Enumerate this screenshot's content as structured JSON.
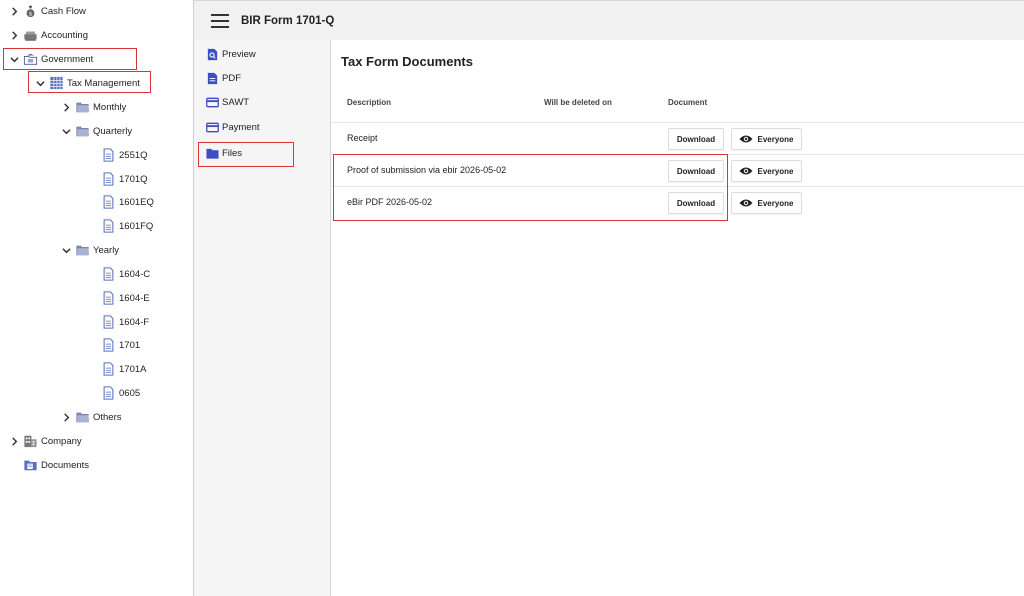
{
  "tree": {
    "cash_flow": "Cash Flow",
    "accounting": "Accounting",
    "government": "Government",
    "tax_management": "Tax Management",
    "monthly": "Monthly",
    "quarterly": "Quarterly",
    "q_items": [
      "2551Q",
      "1701Q",
      "1601EQ",
      "1601FQ"
    ],
    "yearly": "Yearly",
    "y_items": [
      "1604-C",
      "1604-E",
      "1604-F",
      "1701",
      "1701A",
      "0605"
    ],
    "others": "Others",
    "company": "Company",
    "documents": "Documents"
  },
  "header": {
    "title": "BIR Form 1701-Q"
  },
  "form_nav": {
    "preview": "Preview",
    "pdf": "PDF",
    "sawt": "SAWT",
    "payment": "Payment",
    "files": "Files"
  },
  "panel": {
    "title": "Tax Form Documents",
    "columns": {
      "description": "Description",
      "deleted_on": "Will be deleted on",
      "document": "Document"
    },
    "rows": [
      {
        "description": "Receipt",
        "deleted_on": "",
        "download": "Download",
        "visibility": "Everyone"
      },
      {
        "description": "Proof of submission via ebir 2026-05-02",
        "deleted_on": "",
        "download": "Download",
        "visibility": "Everyone"
      },
      {
        "description": "eBir PDF 2026-05-02",
        "deleted_on": "",
        "download": "Download",
        "visibility": "Everyone"
      }
    ]
  },
  "colors": {
    "highlight": "#d9343c",
    "folder": "#6b7aa8",
    "nav_icon": "#3b4fc4",
    "header_bg": "#f1f1f1"
  },
  "icons": {
    "cash_flow": "money-bag-icon",
    "accounting": "cash-register-icon",
    "government": "government-folder-icon",
    "tax_management": "calendar-grid-icon",
    "folder": "folder-icon",
    "document": "document-icon",
    "company": "building-icon",
    "documents": "documents-folder-icon",
    "visibility": "eye-icon"
  }
}
